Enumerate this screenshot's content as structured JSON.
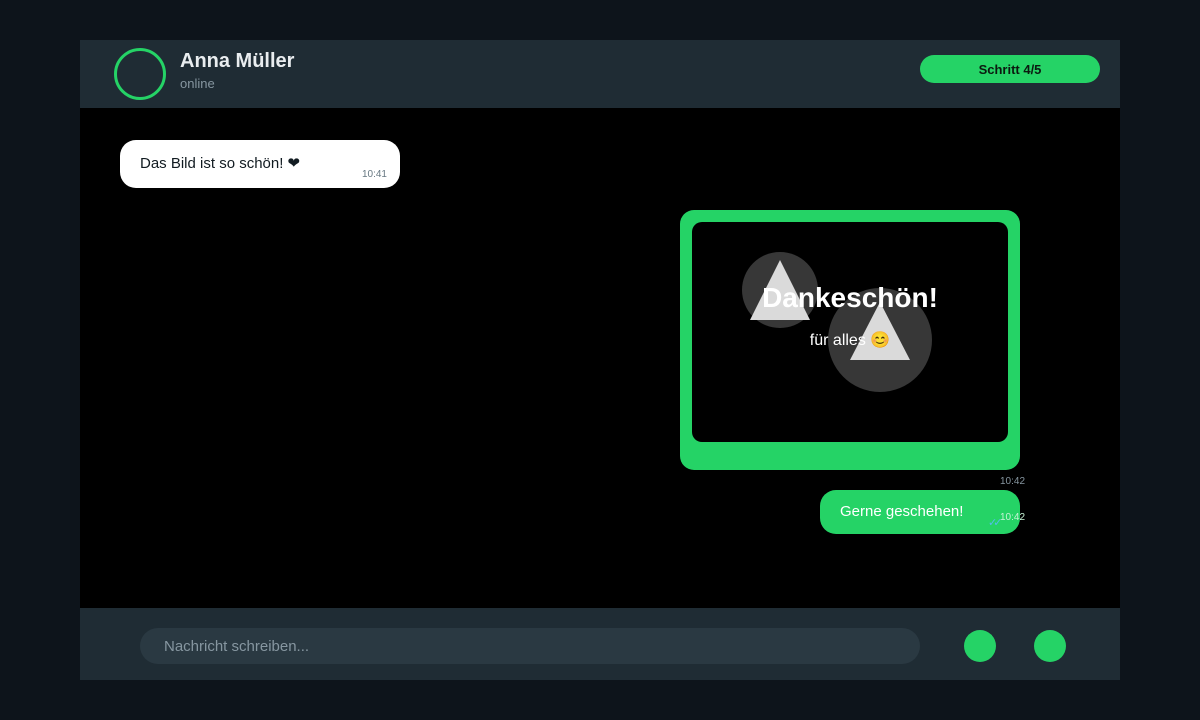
{
  "header": {
    "contact_name": "Anna Müller",
    "status": "online",
    "step_label": "Schritt 4/5"
  },
  "messages": [
    {
      "direction": "incoming",
      "text": "Das Bild ist so schön! ❤",
      "time": "10:41"
    },
    {
      "direction": "outgoing",
      "type": "image",
      "title": "Dankeschön!",
      "subtitle": "für alles 😊",
      "time": "10:42"
    },
    {
      "direction": "outgoing",
      "text": "Gerne geschehen!",
      "time": "10:42",
      "read_ticks": "✓✓"
    }
  ],
  "composer": {
    "placeholder": "Nachricht schreiben..."
  },
  "colors": {
    "accent": "#25d366",
    "header_bg": "#1f2c34",
    "chat_bg": "#000000",
    "page_bg": "#0d141b"
  },
  "icons": {
    "image_placeholder": "image-placeholder-icon",
    "read_receipt": "double-check-icon"
  }
}
